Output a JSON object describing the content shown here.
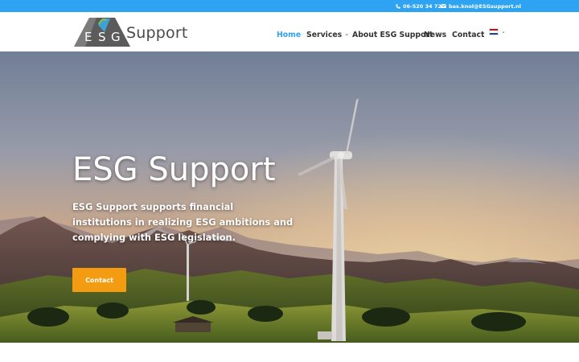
{
  "topbar": {
    "phone": "06-520 34 724",
    "email": "bas.knol@ESGsupport.nl",
    "phone_icon": "phone-icon",
    "email_icon": "envelope-icon",
    "background": "#2ea3f2"
  },
  "header": {
    "logo_letters": {
      "e": "E",
      "s": "S",
      "g": "G"
    },
    "logo_text": "Support",
    "nav": {
      "home": "Home",
      "services": "Services",
      "about": "About ESG Support",
      "news": "News",
      "contact": "Contact"
    },
    "language_flag": "dutch-flag-icon",
    "accent_color": "#2ea3f2"
  },
  "hero": {
    "title": "ESG Support",
    "description": "ESG Support supports financial institutions in realizing ESG ambitions and complying with ESG legislation.",
    "button_label": "Contact",
    "button_color": "#f39c12"
  }
}
